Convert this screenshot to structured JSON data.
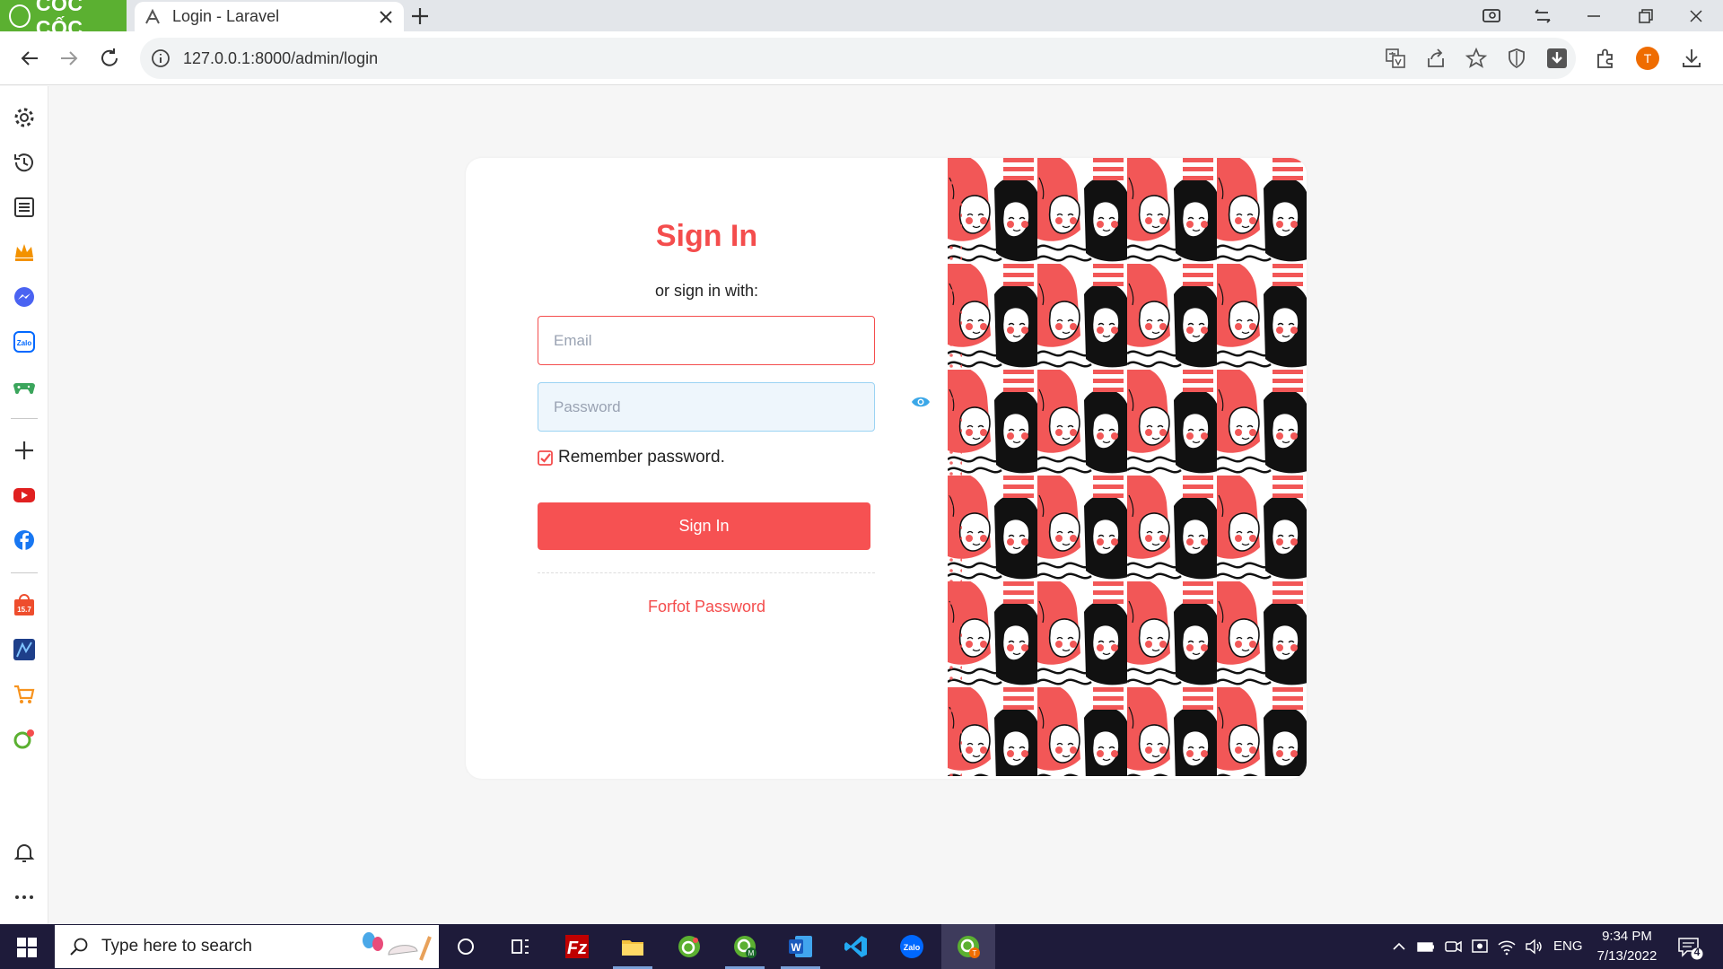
{
  "browser": {
    "brand": "CỐC CỐC",
    "tab_title": "Login - Laravel",
    "url": "127.0.0.1:8000/admin/login"
  },
  "login": {
    "heading": "Sign In",
    "subheading": "or sign in with:",
    "email_placeholder": "Email",
    "password_placeholder": "Password",
    "remember_label": "Remember password.",
    "remember_checked": true,
    "submit_label": "Sign In",
    "forgot_label": "Forfot Password"
  },
  "taskbar": {
    "search_placeholder": "Type here to search",
    "language": "ENG",
    "time": "9:34 PM",
    "date": "7/13/2022",
    "notification_count": "4"
  },
  "colors": {
    "accent": "#f44d4d",
    "button": "#f65152",
    "brand_green": "#5bb031",
    "taskbar": "#1e1b3a"
  }
}
